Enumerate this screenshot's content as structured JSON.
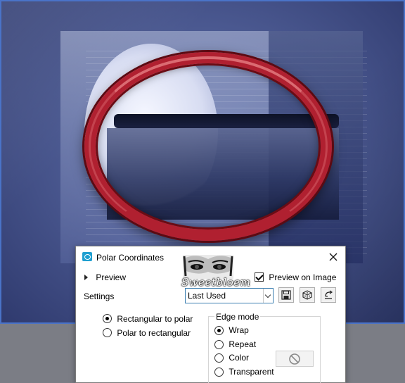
{
  "dialog": {
    "title": "Polar Coordinates",
    "preview_label": "Preview",
    "preview_on_image_label": "Preview on Image",
    "preview_on_image_checked": true,
    "settings_label": "Settings",
    "preset_value": "Last Used",
    "watermark_text": "Sweetbloem",
    "mapping_options": [
      {
        "label": "Rectangular to polar",
        "selected": true
      },
      {
        "label": "Polar to rectangular",
        "selected": false
      }
    ],
    "edge_mode": {
      "title": "Edge mode",
      "options": [
        {
          "label": "Wrap",
          "selected": true
        },
        {
          "label": "Repeat",
          "selected": false
        },
        {
          "label": "Color",
          "selected": false
        },
        {
          "label": "Transparent",
          "selected": false
        }
      ]
    }
  },
  "icons": {
    "app": "polar-coordinates-app-icon",
    "close": "close-icon",
    "expand": "chevron-right-icon",
    "save_preset": "save-icon",
    "randomize": "dice-icon",
    "reset": "reset-icon",
    "no_color": "no-color-icon"
  },
  "colors": {
    "ring": "#b02030",
    "dialog_bg": "#ffffff",
    "app_icon": "#1f9fd0",
    "select_border": "#3c7fb1"
  }
}
